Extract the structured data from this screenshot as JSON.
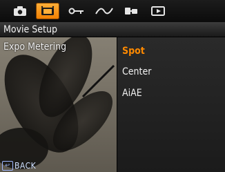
{
  "tabs": [
    {
      "name": "camera-icon"
    },
    {
      "name": "movie-icon",
      "active": true
    },
    {
      "name": "key-icon"
    },
    {
      "name": "curve-icon"
    },
    {
      "name": "connection-icon"
    },
    {
      "name": "playback-icon"
    }
  ],
  "header": {
    "title": "Movie Setup"
  },
  "setting": {
    "label": "Expo Metering"
  },
  "options": [
    "Spot",
    "Center",
    "AiAE"
  ],
  "selected_option": "Spot",
  "footer": {
    "back_label": "BACK"
  },
  "colors": {
    "accent": "#ff8a00",
    "panel": "#222222"
  }
}
